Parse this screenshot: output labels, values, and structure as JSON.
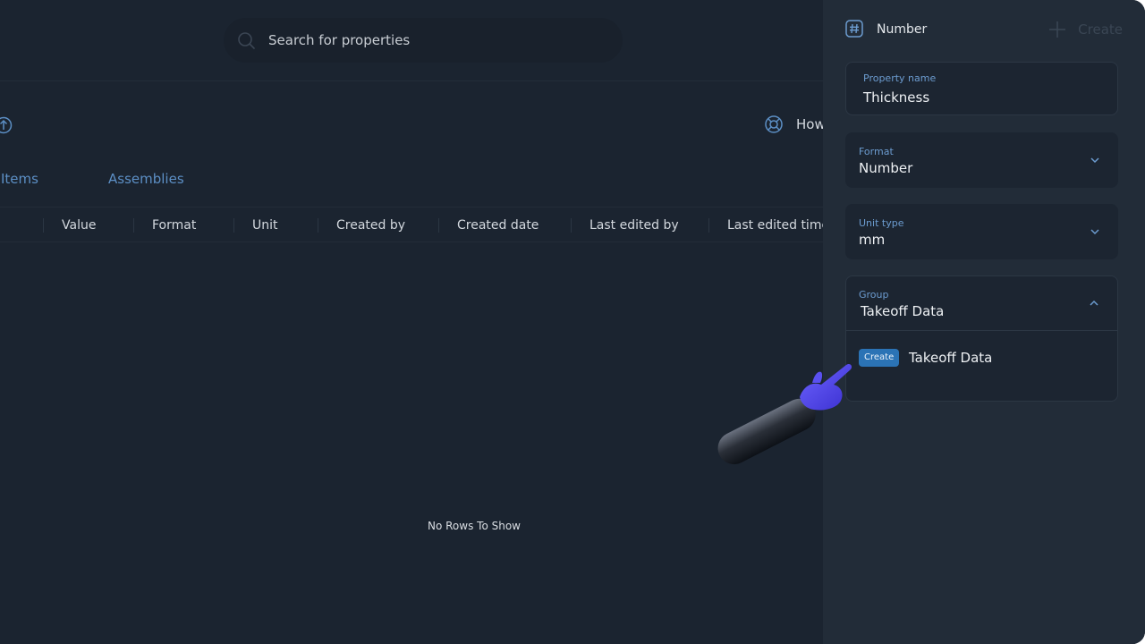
{
  "search": {
    "placeholder": "Search for properties"
  },
  "help": {
    "label": "How"
  },
  "tabs": [
    {
      "label": "Items"
    },
    {
      "label": "Assemblies"
    }
  ],
  "table": {
    "columns": [
      "Value",
      "Format",
      "Unit",
      "Created by",
      "Created date",
      "Last edited by",
      "Last edited time"
    ],
    "empty_message": "No Rows To Show"
  },
  "panel": {
    "type_label": "Number",
    "create_label": "Create",
    "property_name": {
      "label": "Property name",
      "value": "Thickness"
    },
    "format": {
      "label": "Format",
      "value": "Number"
    },
    "unit_type": {
      "label": "Unit type",
      "value": "mm"
    },
    "group": {
      "label": "Group",
      "value": "Takeoff Data",
      "option": {
        "badge": "Create",
        "label": "Takeoff Data"
      }
    }
  },
  "colors": {
    "background": "#1b2430",
    "panel": "#222c38",
    "accent": "#2b73b5",
    "tab_text": "#5c8fc5",
    "pointer_hand": "#4f46e5"
  },
  "icons": [
    "search-icon",
    "upload-icon",
    "lifebuoy-icon",
    "hash-icon",
    "plus-icon",
    "chevron-down-icon",
    "chevron-up-icon",
    "pointer-hand-icon"
  ]
}
